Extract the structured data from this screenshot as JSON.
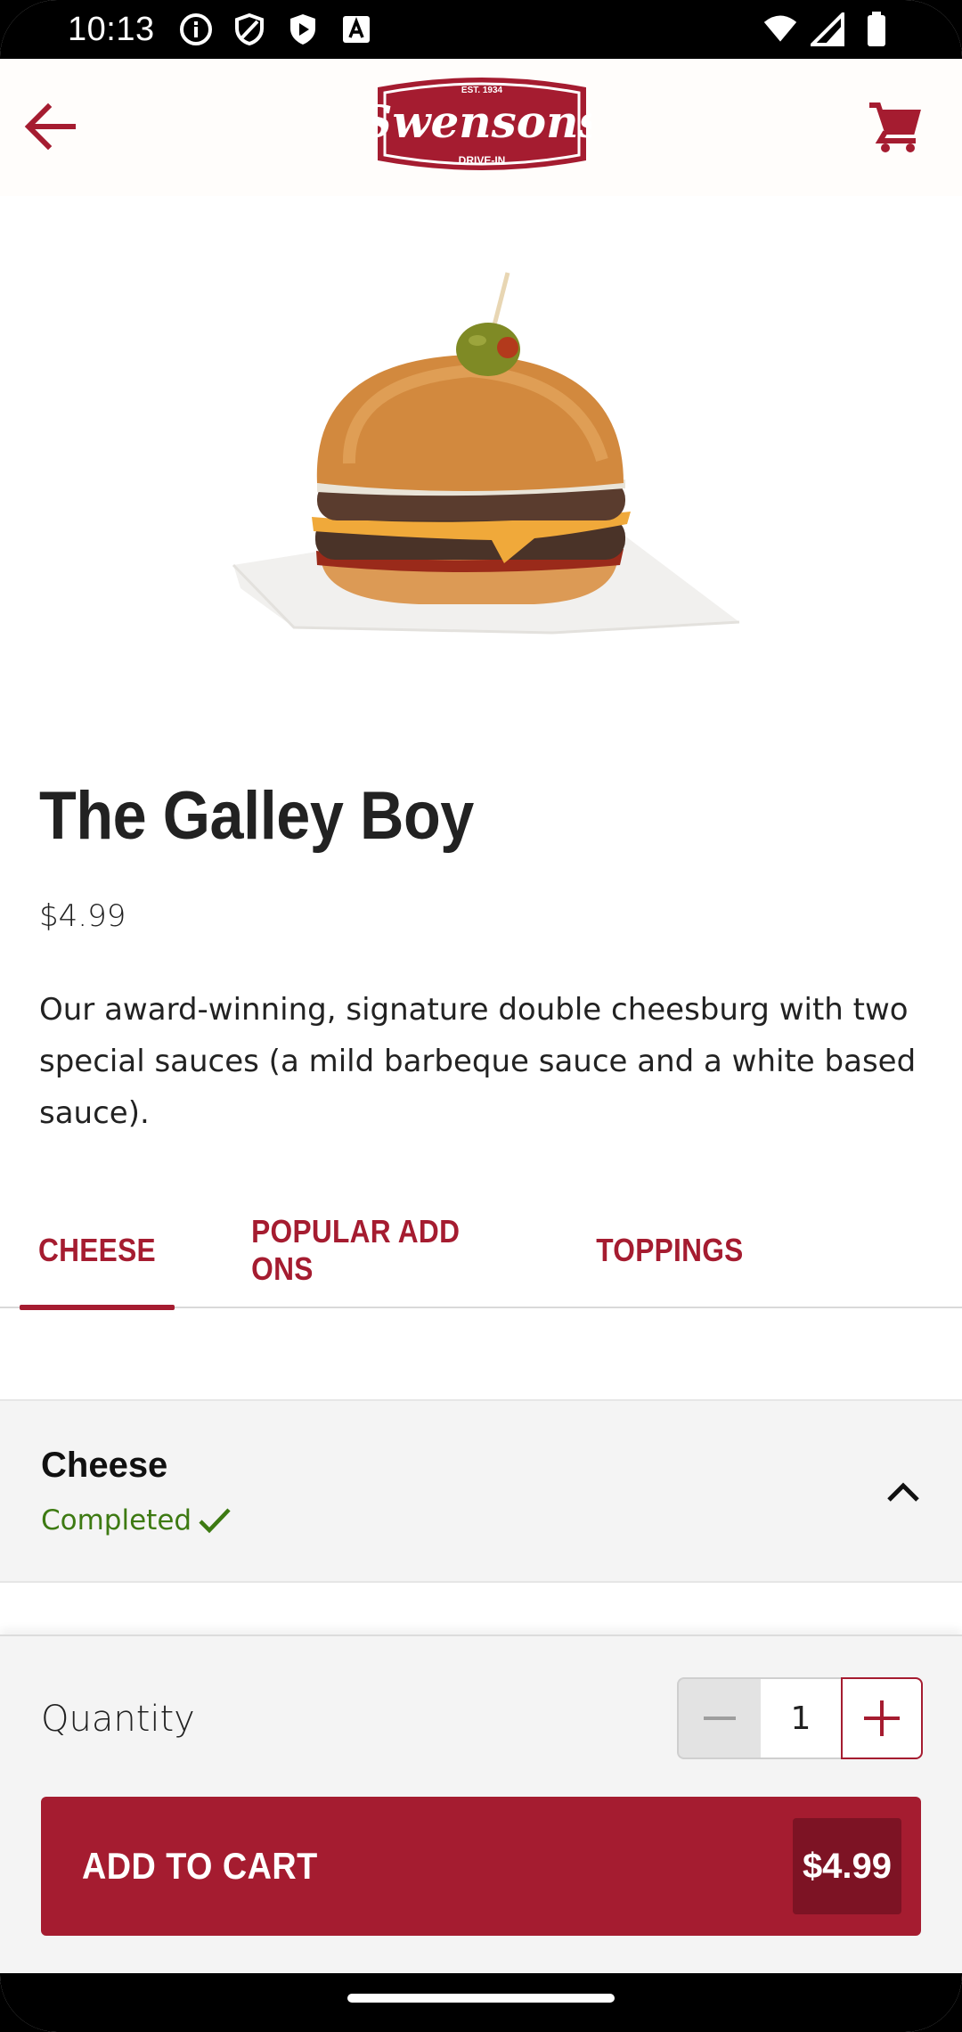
{
  "status_bar": {
    "time": "10:13",
    "left_icons": [
      "info-icon",
      "shield-icon",
      "play-icon",
      "font-icon"
    ],
    "right_icons": [
      "wifi-icon",
      "signal-icon",
      "battery-icon"
    ]
  },
  "header": {
    "logo_top": "EST. 1934",
    "logo_name": "Swensons",
    "logo_bottom": "DRIVE-IN",
    "back_icon": "back-arrow-icon",
    "cart_icon": "cart-icon"
  },
  "product": {
    "title": "The Galley Boy",
    "price": "$4.99",
    "description": "Our award-winning, signature double cheesburg with two special sauces (a mild barbeque sauce and a white based sauce)."
  },
  "tabs": [
    {
      "label": "CHEESE",
      "active": true
    },
    {
      "label": "POPULAR ADD ONS",
      "active": false
    },
    {
      "label": "TOPPINGS",
      "active": false
    }
  ],
  "accordion": {
    "title": "Cheese",
    "status": "Completed"
  },
  "quantity": {
    "label": "Quantity",
    "value": "1"
  },
  "cart_button": {
    "label": "ADD TO CART",
    "price": "$4.99"
  },
  "colors": {
    "brand": "#a51c30",
    "brand_dark": "#7d1324",
    "success": "#3d7a12"
  }
}
